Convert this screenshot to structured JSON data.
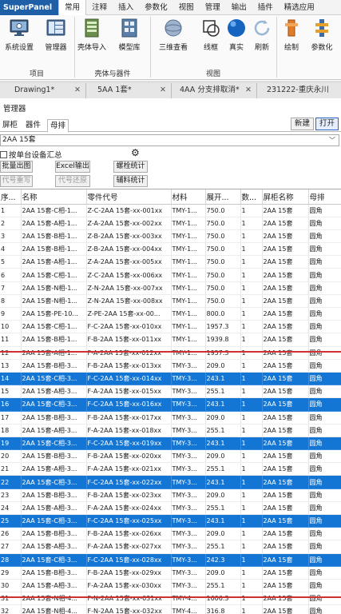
{
  "ribbon": {
    "tabs": [
      "SuperPanel",
      "常用",
      "注释",
      "插入",
      "参数化",
      "视图",
      "管理",
      "输出",
      "插件",
      "精选应用"
    ],
    "buttons": {
      "system_settings": "系统设置",
      "manager": "管理器",
      "shell_import": "壳体导入",
      "model_library": "模型库",
      "view_3d": "三维查看",
      "wireframe": "线框",
      "realistic": "真实",
      "refresh": "刷新",
      "draw": "绘制",
      "parametric": "参数化"
    },
    "groups": {
      "project": "项目",
      "shell_parts": "壳体与器件",
      "view": "视图"
    }
  },
  "doc_tabs": [
    "Drawing1*",
    "5AA 1套*",
    "4AA 分支排取消*",
    "231222-重庆永川"
  ],
  "panel": {
    "title": "管理器",
    "tabs": [
      "屏柜",
      "器件",
      "母排"
    ],
    "new_label": "新建",
    "open_label": "打开",
    "selector_value": "2AA 15套",
    "checkbox_label": "按单台设备汇总",
    "actions": {
      "batch_drawing": "批量出图",
      "excel_export": "Excel输出",
      "bolt_stats": "螺栓统计",
      "code_rewrite": "代号重写",
      "code_restore": "代号还原",
      "aux_stats": "辅料统计"
    }
  },
  "table": {
    "headers": [
      "序...",
      "名称",
      "零件代号",
      "材料",
      "展开...",
      "数...",
      "屏柜名称",
      "母排"
    ],
    "rows": [
      {
        "selected": false,
        "cells": [
          "1",
          "2AA 15套-C相-1...",
          "Z-C-2AA 15套-xx-001xx",
          "TMY-1...",
          "750.0",
          "1",
          "2AA 15套",
          "圆角"
        ]
      },
      {
        "selected": false,
        "cells": [
          "2",
          "2AA 15套-A相-1...",
          "Z-A-2AA 15套-xx-002xx",
          "TMY-1...",
          "750.0",
          "1",
          "2AA 15套",
          "圆角"
        ]
      },
      {
        "selected": false,
        "cells": [
          "3",
          "2AA 15套-B相-1...",
          "Z-B-2AA 15套-xx-003xx",
          "TMY-1...",
          "750.0",
          "1",
          "2AA 15套",
          "圆角"
        ]
      },
      {
        "selected": false,
        "cells": [
          "4",
          "2AA 15套-B相-1...",
          "Z-B-2AA 15套-xx-004xx",
          "TMY-1...",
          "750.0",
          "1",
          "2AA 15套",
          "圆角"
        ]
      },
      {
        "selected": false,
        "cells": [
          "5",
          "2AA 15套-A相-1...",
          "Z-A-2AA 15套-xx-005xx",
          "TMY-1...",
          "750.0",
          "1",
          "2AA 15套",
          "圆角"
        ]
      },
      {
        "selected": false,
        "cells": [
          "6",
          "2AA 15套-C相-1...",
          "Z-C-2AA 15套-xx-006xx",
          "TMY-1...",
          "750.0",
          "1",
          "2AA 15套",
          "圆角"
        ]
      },
      {
        "selected": false,
        "cells": [
          "7",
          "2AA 15套-N相-1...",
          "Z-N-2AA 15套-xx-007xx",
          "TMY-1...",
          "750.0",
          "1",
          "2AA 15套",
          "圆角"
        ]
      },
      {
        "selected": false,
        "cells": [
          "8",
          "2AA 15套-N相-1...",
          "Z-N-2AA 15套-xx-008xx",
          "TMY-1...",
          "750.0",
          "1",
          "2AA 15套",
          "圆角"
        ]
      },
      {
        "selected": false,
        "cells": [
          "9",
          "2AA 15套-PE-10...",
          "Z-PE-2AA 15套-xx-00...",
          "TMY-1...",
          "800.0",
          "1",
          "2AA 15套",
          "圆角"
        ]
      },
      {
        "selected": false,
        "cells": [
          "10",
          "2AA 15套-C相-1...",
          "F-C-2AA 15套-xx-010xx",
          "TMY-1...",
          "1957.3",
          "1",
          "2AA 15套",
          "圆角"
        ]
      },
      {
        "selected": false,
        "cells": [
          "11",
          "2AA 15套-B相-1...",
          "F-B-2AA 15套-xx-011xx",
          "TMY-1...",
          "1939.8",
          "1",
          "2AA 15套",
          "圆角"
        ]
      },
      {
        "selected": false,
        "cells": [
          "12",
          "2AA 15套-A相-1...",
          "F-A-2AA 15套-xx-012xx",
          "TMY-1...",
          "1957.3",
          "1",
          "2AA 15套",
          "圆角"
        ]
      },
      {
        "selected": false,
        "cells": [
          "13",
          "2AA 15套-B相-3...",
          "F-B-2AA 15套-xx-013xx",
          "TMY-3...",
          "209.0",
          "1",
          "2AA 15套",
          "圆角"
        ]
      },
      {
        "selected": true,
        "cells": [
          "14",
          "2AA 15套-C相-3...",
          "F-C-2AA 15套-xx-014xx",
          "TMY-3...",
          "243.1",
          "1",
          "2AA 15套",
          "圆角"
        ]
      },
      {
        "selected": false,
        "cells": [
          "15",
          "2AA 15套-A相-3...",
          "F-A-2AA 15套-xx-015xx",
          "TMY-3...",
          "255.1",
          "1",
          "2AA 15套",
          "圆角"
        ]
      },
      {
        "selected": true,
        "cells": [
          "16",
          "2AA 15套-C相-3...",
          "F-C-2AA 15套-xx-016xx",
          "TMY-3...",
          "243.1",
          "1",
          "2AA 15套",
          "圆角"
        ]
      },
      {
        "selected": false,
        "cells": [
          "17",
          "2AA 15套-B相-3...",
          "F-B-2AA 15套-xx-017xx",
          "TMY-3...",
          "209.0",
          "1",
          "2AA 15套",
          "圆角"
        ]
      },
      {
        "selected": false,
        "cells": [
          "18",
          "2AA 15套-A相-3...",
          "F-A-2AA 15套-xx-018xx",
          "TMY-3...",
          "255.1",
          "1",
          "2AA 15套",
          "圆角"
        ]
      },
      {
        "selected": true,
        "cells": [
          "19",
          "2AA 15套-C相-3...",
          "F-C-2AA 15套-xx-019xx",
          "TMY-3...",
          "243.1",
          "1",
          "2AA 15套",
          "圆角"
        ]
      },
      {
        "selected": false,
        "cells": [
          "20",
          "2AA 15套-B相-3...",
          "F-B-2AA 15套-xx-020xx",
          "TMY-3...",
          "209.0",
          "1",
          "2AA 15套",
          "圆角"
        ]
      },
      {
        "selected": false,
        "cells": [
          "21",
          "2AA 15套-A相-3...",
          "F-A-2AA 15套-xx-021xx",
          "TMY-3...",
          "255.1",
          "1",
          "2AA 15套",
          "圆角"
        ]
      },
      {
        "selected": true,
        "cells": [
          "22",
          "2AA 15套-C相-3...",
          "F-C-2AA 15套-xx-022xx",
          "TMY-3...",
          "243.1",
          "1",
          "2AA 15套",
          "圆角"
        ]
      },
      {
        "selected": false,
        "cells": [
          "23",
          "2AA 15套-B相-3...",
          "F-B-2AA 15套-xx-023xx",
          "TMY-3...",
          "209.0",
          "1",
          "2AA 15套",
          "圆角"
        ]
      },
      {
        "selected": false,
        "cells": [
          "24",
          "2AA 15套-A相-3...",
          "F-A-2AA 15套-xx-024xx",
          "TMY-3...",
          "255.1",
          "1",
          "2AA 15套",
          "圆角"
        ]
      },
      {
        "selected": true,
        "cells": [
          "25",
          "2AA 15套-C相-3...",
          "F-C-2AA 15套-xx-025xx",
          "TMY-3...",
          "243.1",
          "1",
          "2AA 15套",
          "圆角"
        ]
      },
      {
        "selected": false,
        "cells": [
          "26",
          "2AA 15套-B相-3...",
          "F-B-2AA 15套-xx-026xx",
          "TMY-3...",
          "209.0",
          "1",
          "2AA 15套",
          "圆角"
        ]
      },
      {
        "selected": false,
        "cells": [
          "27",
          "2AA 15套-A相-3...",
          "F-A-2AA 15套-xx-027xx",
          "TMY-3...",
          "255.1",
          "1",
          "2AA 15套",
          "圆角"
        ]
      },
      {
        "selected": true,
        "cells": [
          "28",
          "2AA 15套-C相-3...",
          "F-C-2AA 15套-xx-028xx",
          "TMY-3...",
          "242.3",
          "1",
          "2AA 15套",
          "圆角"
        ]
      },
      {
        "selected": false,
        "cells": [
          "29",
          "2AA 15套-B相-3...",
          "F-B-2AA 15套-xx-029xx",
          "TMY-3...",
          "209.0",
          "1",
          "2AA 15套",
          "圆角"
        ]
      },
      {
        "selected": false,
        "cells": [
          "30",
          "2AA 15套-A相-3...",
          "F-A-2AA 15套-xx-030xx",
          "TMY-3...",
          "255.1",
          "1",
          "2AA 15套",
          "圆角"
        ]
      },
      {
        "selected": false,
        "cells": [
          "31",
          "2AA 15套-N相-4...",
          "F-N-2AA 15套-xx-031xx",
          "TMY-4...",
          "1606.3",
          "1",
          "2AA 15套",
          "圆角"
        ]
      },
      {
        "selected": false,
        "cells": [
          "32",
          "2AA 15套-N相-4...",
          "F-N-2AA 15套-xx-032xx",
          "TMY-4...",
          "316.8",
          "1",
          "2AA 15套",
          "圆角"
        ]
      }
    ]
  },
  "colors": {
    "selection": "#1476d4",
    "annotation_red": "#d0312d",
    "app_tab": "#1f5fa8"
  }
}
